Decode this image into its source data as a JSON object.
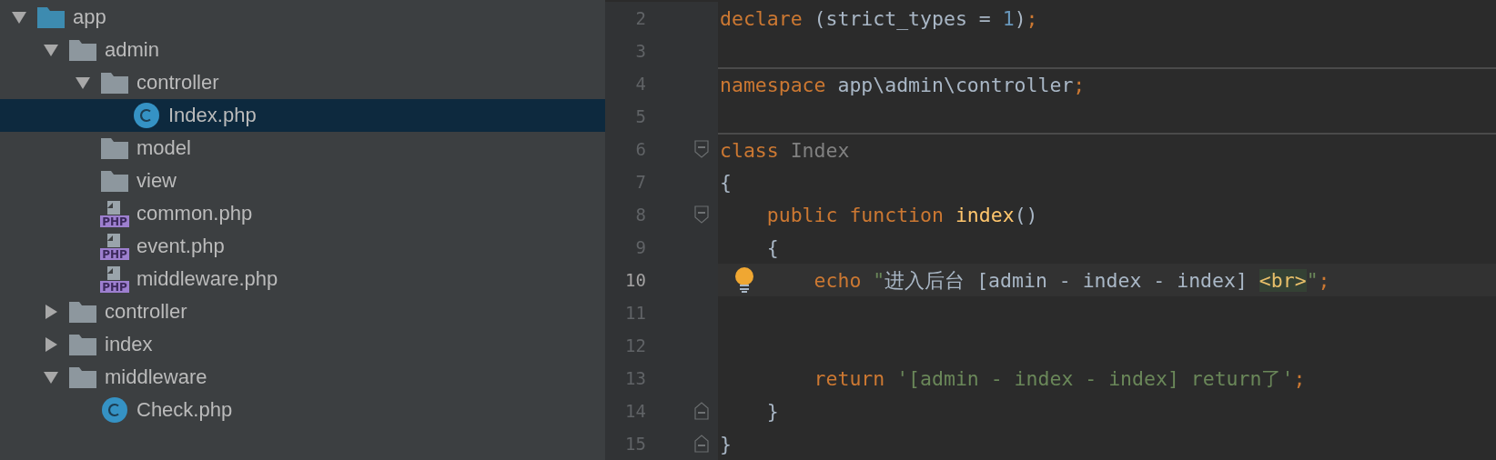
{
  "project_tree": [
    {
      "name": "app",
      "kind": "root-folder",
      "expanded": true,
      "selected": false,
      "children": [
        {
          "name": "admin",
          "kind": "folder",
          "expanded": true,
          "selected": false,
          "children": [
            {
              "name": "controller",
              "kind": "folder",
              "expanded": true,
              "selected": false,
              "children": [
                {
                  "name": "Index.php",
                  "kind": "class",
                  "selected": true
                }
              ]
            },
            {
              "name": "model",
              "kind": "folder",
              "selected": false
            },
            {
              "name": "view",
              "kind": "folder",
              "selected": false
            },
            {
              "name": "common.php",
              "kind": "php",
              "icon_label": "PHP",
              "selected": false
            },
            {
              "name": "event.php",
              "kind": "php",
              "icon_label": "PHP",
              "selected": false
            },
            {
              "name": "middleware.php",
              "kind": "php",
              "icon_label": "PHP",
              "selected": false
            }
          ]
        },
        {
          "name": "controller",
          "kind": "folder",
          "expanded": false,
          "selected": false
        },
        {
          "name": "index",
          "kind": "folder",
          "expanded": false,
          "selected": false
        },
        {
          "name": "middleware",
          "kind": "folder",
          "expanded": true,
          "selected": false,
          "children": [
            {
              "name": "Check.php",
              "kind": "class",
              "selected": false
            }
          ]
        }
      ]
    }
  ],
  "editor": {
    "lines": [
      {
        "number": "2",
        "current": false,
        "separator_above": false,
        "fold_start": false,
        "fold_end": false,
        "bulb": false,
        "tokens": [
          {
            "kind": "keyword",
            "text": "declare"
          },
          {
            "kind": "plain",
            "text": " (strict_types = "
          },
          {
            "kind": "number",
            "text": "1"
          },
          {
            "kind": "plain",
            "text": ")"
          },
          {
            "kind": "keyword",
            "text": ";"
          }
        ]
      },
      {
        "number": "3",
        "current": false,
        "separator_above": false,
        "fold_start": false,
        "fold_end": false,
        "bulb": false
      },
      {
        "number": "4",
        "current": false,
        "separator_above": true,
        "fold_start": false,
        "fold_end": false,
        "bulb": false,
        "tokens": [
          {
            "kind": "keyword",
            "text": "namespace"
          },
          {
            "kind": "plain",
            "text": " app\\admin\\controller"
          },
          {
            "kind": "keyword",
            "text": ";"
          }
        ]
      },
      {
        "number": "5",
        "current": false,
        "separator_above": false,
        "fold_start": false,
        "fold_end": false,
        "bulb": false
      },
      {
        "number": "6",
        "current": false,
        "separator_above": true,
        "fold_start": true,
        "fold_end": false,
        "bulb": false,
        "tokens": [
          {
            "kind": "keyword",
            "text": "class"
          },
          {
            "kind": "classname",
            "text": " Index"
          }
        ]
      },
      {
        "number": "7",
        "current": false,
        "separator_above": false,
        "fold_start": false,
        "fold_end": false,
        "bulb": false,
        "tokens": [
          {
            "kind": "plain",
            "text": "{"
          }
        ]
      },
      {
        "number": "8",
        "current": false,
        "separator_above": false,
        "fold_start": true,
        "fold_end": false,
        "bulb": false,
        "tokens": [
          {
            "kind": "keyword",
            "text": "    public function "
          },
          {
            "kind": "function",
            "text": "index"
          },
          {
            "kind": "plain",
            "text": "()"
          }
        ]
      },
      {
        "number": "9",
        "current": false,
        "separator_above": false,
        "fold_start": false,
        "fold_end": false,
        "bulb": false,
        "tokens": [
          {
            "kind": "plain",
            "text": "    {"
          }
        ]
      },
      {
        "number": "10",
        "current": true,
        "separator_above": false,
        "fold_start": false,
        "fold_end": false,
        "bulb": true,
        "tokens": [
          {
            "kind": "keyword",
            "text": "        echo "
          },
          {
            "kind": "string",
            "text": "\""
          },
          {
            "kind": "injected",
            "text": "进入后台 [admin - index - index] "
          },
          {
            "kind": "tag",
            "text": "<br>"
          },
          {
            "kind": "string",
            "text": "\""
          },
          {
            "kind": "keyword",
            "text": ";"
          }
        ]
      },
      {
        "number": "11",
        "current": false,
        "separator_above": false,
        "fold_start": false,
        "fold_end": false,
        "bulb": false
      },
      {
        "number": "12",
        "current": false,
        "separator_above": false,
        "fold_start": false,
        "fold_end": false,
        "bulb": false
      },
      {
        "number": "13",
        "current": false,
        "separator_above": false,
        "fold_start": false,
        "fold_end": false,
        "bulb": false,
        "tokens": [
          {
            "kind": "keyword",
            "text": "        return "
          },
          {
            "kind": "string",
            "text": "'[admin - index - index] return了'"
          },
          {
            "kind": "keyword",
            "text": ";"
          }
        ]
      },
      {
        "number": "14",
        "current": false,
        "separator_above": false,
        "fold_start": false,
        "fold_end": true,
        "bulb": false,
        "tokens": [
          {
            "kind": "plain",
            "text": "    }"
          }
        ]
      },
      {
        "number": "15",
        "current": false,
        "separator_above": false,
        "fold_start": false,
        "fold_end": true,
        "bulb": false,
        "tokens": [
          {
            "kind": "plain",
            "text": "}"
          }
        ]
      }
    ]
  }
}
